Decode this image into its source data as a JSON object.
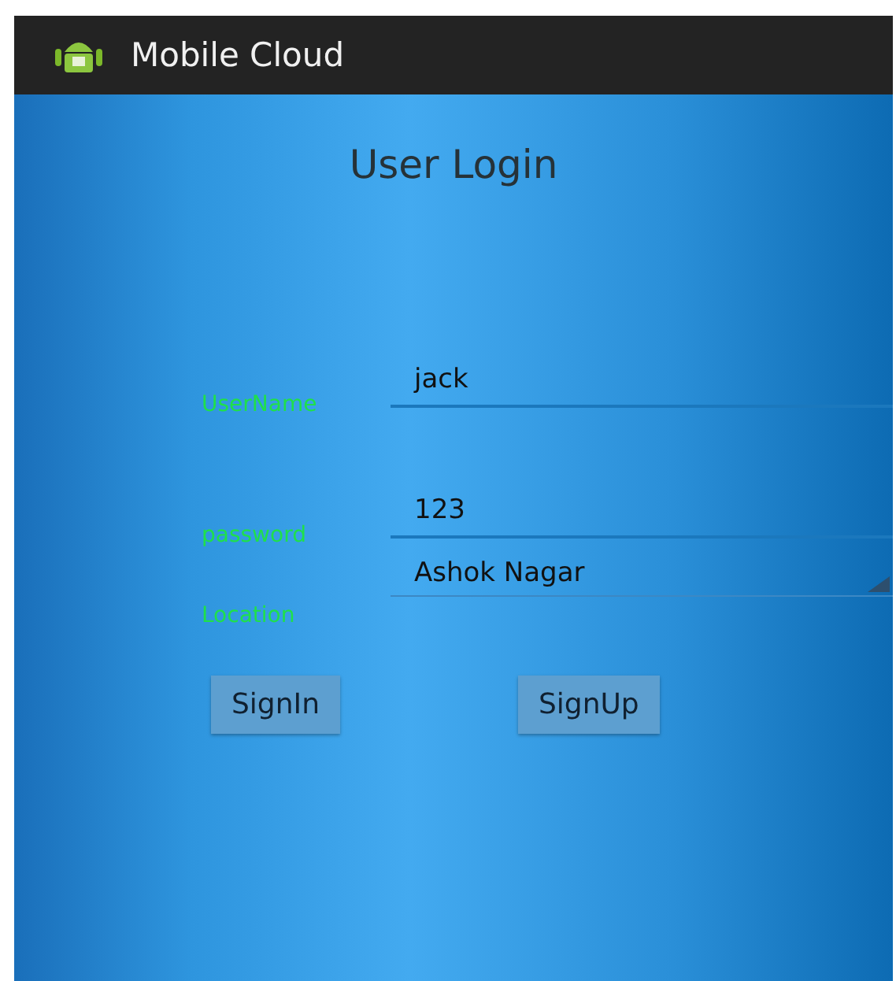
{
  "action_bar": {
    "title": "Mobile Cloud"
  },
  "heading": "User Login",
  "fields": [
    {
      "kind": "text",
      "label": "UserName",
      "value": "jack"
    },
    {
      "kind": "text",
      "label": "password",
      "value": "123"
    },
    {
      "kind": "spinner",
      "label": "Location",
      "value": "Ashok Nagar"
    }
  ],
  "buttons": [
    "SignIn",
    "SignUp"
  ]
}
